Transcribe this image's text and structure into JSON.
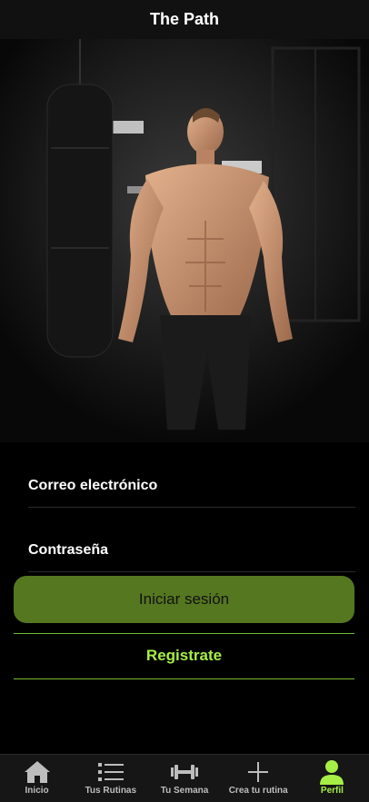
{
  "header": {
    "title": "The Path"
  },
  "hero": {
    "image": "man-gym-photo"
  },
  "form": {
    "email_label": "Correo electrónico",
    "password_label": "Contraseña",
    "login_button": "Iniciar sesión",
    "register_link": "Registrate"
  },
  "tabbar": {
    "items": [
      {
        "label": "Inicio",
        "icon": "home-icon",
        "active": false
      },
      {
        "label": "Tus Rutinas",
        "icon": "list-icon",
        "active": false
      },
      {
        "label": "Tu Semana",
        "icon": "dumbbell-icon",
        "active": false
      },
      {
        "label": "Crea tu rutina",
        "icon": "plus-icon",
        "active": false
      },
      {
        "label": "Perfil",
        "icon": "person-icon",
        "active": true
      }
    ]
  },
  "colors": {
    "accent": "#a6ee46",
    "button": "#557720",
    "background": "#000000"
  }
}
